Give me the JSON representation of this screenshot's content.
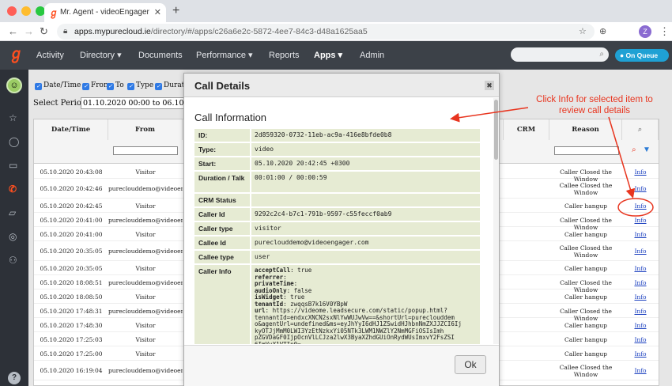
{
  "browser": {
    "tab_title": "Mr. Agent - videoEngager",
    "url_host": "apps.mypurecloud.ie",
    "url_path": "/directory/#/apps/c26a6e2c-5872-4ee7-84c3-d48a1625aa5",
    "profile_initial": "Z"
  },
  "nav": {
    "items": [
      "Activity",
      "Directory",
      "Documents",
      "Performance",
      "Reports",
      "Apps",
      "Admin"
    ],
    "active": "Apps",
    "on_queue": "On Queue"
  },
  "report": {
    "filters": [
      "Date/Time",
      "From",
      "To",
      "Type",
      "Duratio"
    ],
    "period_label": "Select Period:",
    "period_value": "01.10.2020 00:00 to 06.10.2020",
    "columns": [
      "Date/Time",
      "From",
      "CRM",
      "Reason"
    ],
    "rows": [
      {
        "date": "05.10.2020 20:43:08",
        "from": "Visitor",
        "reason": "Caller Closed the Window",
        "info": "Info"
      },
      {
        "date": "05.10.2020 20:42:46",
        "from": "pureclouddemo@videoengager",
        "reason": "Callee Closed the Window",
        "info": "Info"
      },
      {
        "date": "05.10.2020 20:42:45",
        "from": "Visitor",
        "reason": "Caller hangup",
        "info": "Info"
      },
      {
        "date": "05.10.2020 20:41:00",
        "from": "pureclouddemo@videoengager",
        "reason": "Caller Closed the Window",
        "info": "Info"
      },
      {
        "date": "05.10.2020 20:41:00",
        "from": "Visitor",
        "reason": "Caller hangup",
        "info": "Info"
      },
      {
        "date": "05.10.2020 20:35:05",
        "from": "pureclouddemo@videoengager",
        "reason": "Callee Closed the Window",
        "info": "Info"
      },
      {
        "date": "05.10.2020 20:35:05",
        "from": "Visitor",
        "reason": "Caller hangup",
        "info": "Info"
      },
      {
        "date": "05.10.2020 18:08:51",
        "from": "pureclouddemo@videoengager",
        "reason": "Caller Closed the Window",
        "info": "Info"
      },
      {
        "date": "05.10.2020 18:08:50",
        "from": "Visitor",
        "reason": "Caller hangup",
        "info": "Info"
      },
      {
        "date": "05.10.2020 17:48:31",
        "from": "pureclouddemo@videoengager",
        "reason": "Caller Closed the Window",
        "info": "Info"
      },
      {
        "date": "05.10.2020 17:48:30",
        "from": "Visitor",
        "reason": "Caller hangup",
        "info": "Info"
      },
      {
        "date": "05.10.2020 17:25:03",
        "from": "Visitor",
        "reason": "Caller hangup",
        "info": "Info"
      },
      {
        "date": "05.10.2020 17:25:00",
        "from": "Visitor",
        "reason": "Caller hangup",
        "info": "Info"
      },
      {
        "date": "05.10.2020 16:19:04",
        "from": "pureclouddemo@videoengager",
        "reason": "Callee Closed the Window",
        "info": "Info"
      }
    ]
  },
  "modal": {
    "title": "Call Details",
    "section": "Call Information",
    "fields": [
      {
        "label": "ID:",
        "value": "2d859320-0732-11eb-ac9a-416e8bfde0b8"
      },
      {
        "label": "Type:",
        "value": "video"
      },
      {
        "label": "Start:",
        "value": "05.10.2020 20:42:45 +0300"
      },
      {
        "label": "Duration / Talk",
        "value": "00:01:00 / 00:00:59"
      },
      {
        "label": "CRM Status",
        "value": ""
      },
      {
        "label": "Caller Id",
        "value": "9292c2c4-b7c1-791b-9597-c55feccf0ab9"
      },
      {
        "label": "Caller type",
        "value": "visitor"
      },
      {
        "label": "Callee Id",
        "value": "pureclouddemo@videoengager.com"
      },
      {
        "label": "Callee type",
        "value": "user"
      },
      {
        "label": "Caller Info",
        "value": ""
      }
    ],
    "caller_info": [
      {
        "key": "acceptCall",
        "value": ": true"
      },
      {
        "key": "referrer",
        "value": ":"
      },
      {
        "key": "privateTime",
        "value": ":"
      },
      {
        "key": "audioOnly",
        "value": ": false"
      },
      {
        "key": "isWidget",
        "value": ": true"
      },
      {
        "key": "tenantId",
        "value": ": zwqqsB7k16V0YBpW"
      },
      {
        "key": "url",
        "value": ": https://videome.leadsecure.com/static/popup.html?"
      },
      {
        "key": "",
        "value": "tennantId=endxcXNCN2sxNlYwWUJwVw==&shortUrl=pureclouddem"
      },
      {
        "key": "",
        "value": "o&agentUrl=undefined&ms=eyJhYyI6dHJ1ZSwidHJhbnNmZXJJZCI6Ij"
      },
      {
        "key": "",
        "value": "kyOTJjMmM0LWI3YzEtNzkxYi05NTk3LWM1NWZlY2NmMGFiOSIsImh"
      },
      {
        "key": "",
        "value": "pZGVDaGF0IjpOcnVlLCJza2lwX3ByaXZhdGUiOnRydWUsImxvY2FsZSI"
      },
      {
        "key": "",
        "value": "6ImVuX1VTIn0="
      }
    ],
    "ok_label": "Ok"
  },
  "annotation": {
    "text": "Click Info for selected item to review call details",
    "color": "#e8351f"
  }
}
